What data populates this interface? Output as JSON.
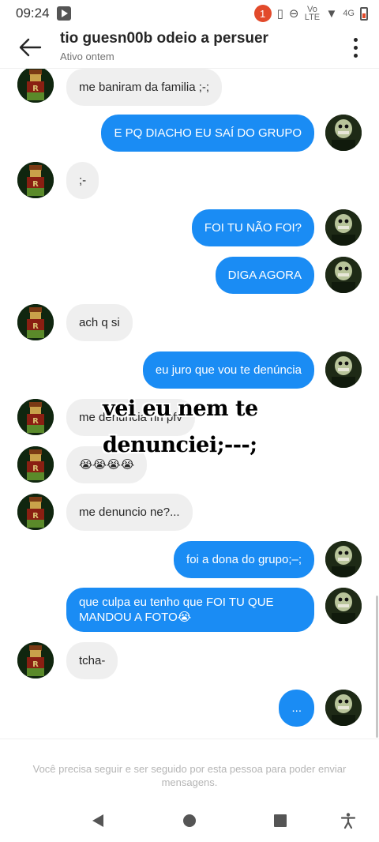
{
  "status_bar": {
    "time": "09:24",
    "notification_count": "1",
    "volte_label": "Vo LTE",
    "network": "4G"
  },
  "header": {
    "title": "tio guesn00b odeio a persuer",
    "subtitle": "Ativo ontem"
  },
  "messages": [
    {
      "sender": "them",
      "text": "me baniram da familia ;-;"
    },
    {
      "sender": "me",
      "text": "E PQ DIACHO EU SAÍ DO GRUPO"
    },
    {
      "sender": "them",
      "text": ";-"
    },
    {
      "sender": "me",
      "text": "FOI TU NÃO FOI?"
    },
    {
      "sender": "me",
      "text": "DIGA AGORA"
    },
    {
      "sender": "them",
      "text": "ach q si"
    },
    {
      "sender": "me",
      "text": "eu juro que vou te denúncia"
    },
    {
      "sender": "them",
      "text": "me denuncia nn pfv"
    },
    {
      "sender": "them",
      "text": "😭😭😭😭"
    },
    {
      "sender": "them",
      "text": "me denuncio ne?..."
    },
    {
      "sender": "me",
      "text": "foi a dona do grupo;–;"
    },
    {
      "sender": "me",
      "text": "que culpa eu tenho que FOI TU QUE MANDOU A FOTO😭"
    },
    {
      "sender": "them",
      "text": "tcha-"
    },
    {
      "sender": "me",
      "text": "..."
    }
  ],
  "overlay_caption": {
    "line1": "vei eu nem te",
    "line2": "denunciei;---;"
  },
  "footer_notice": "Você precisa seguir e ser seguido por esta pessoa para poder enviar mensagens.",
  "colors": {
    "sent_bubble": "#1a8cf4",
    "received_bubble": "#efefef",
    "notification_badge": "#e24a2b"
  },
  "icons": [
    "back-arrow-icon",
    "more-options-icon",
    "nav-back-icon",
    "nav-home-icon",
    "nav-recents-icon",
    "accessibility-icon"
  ]
}
